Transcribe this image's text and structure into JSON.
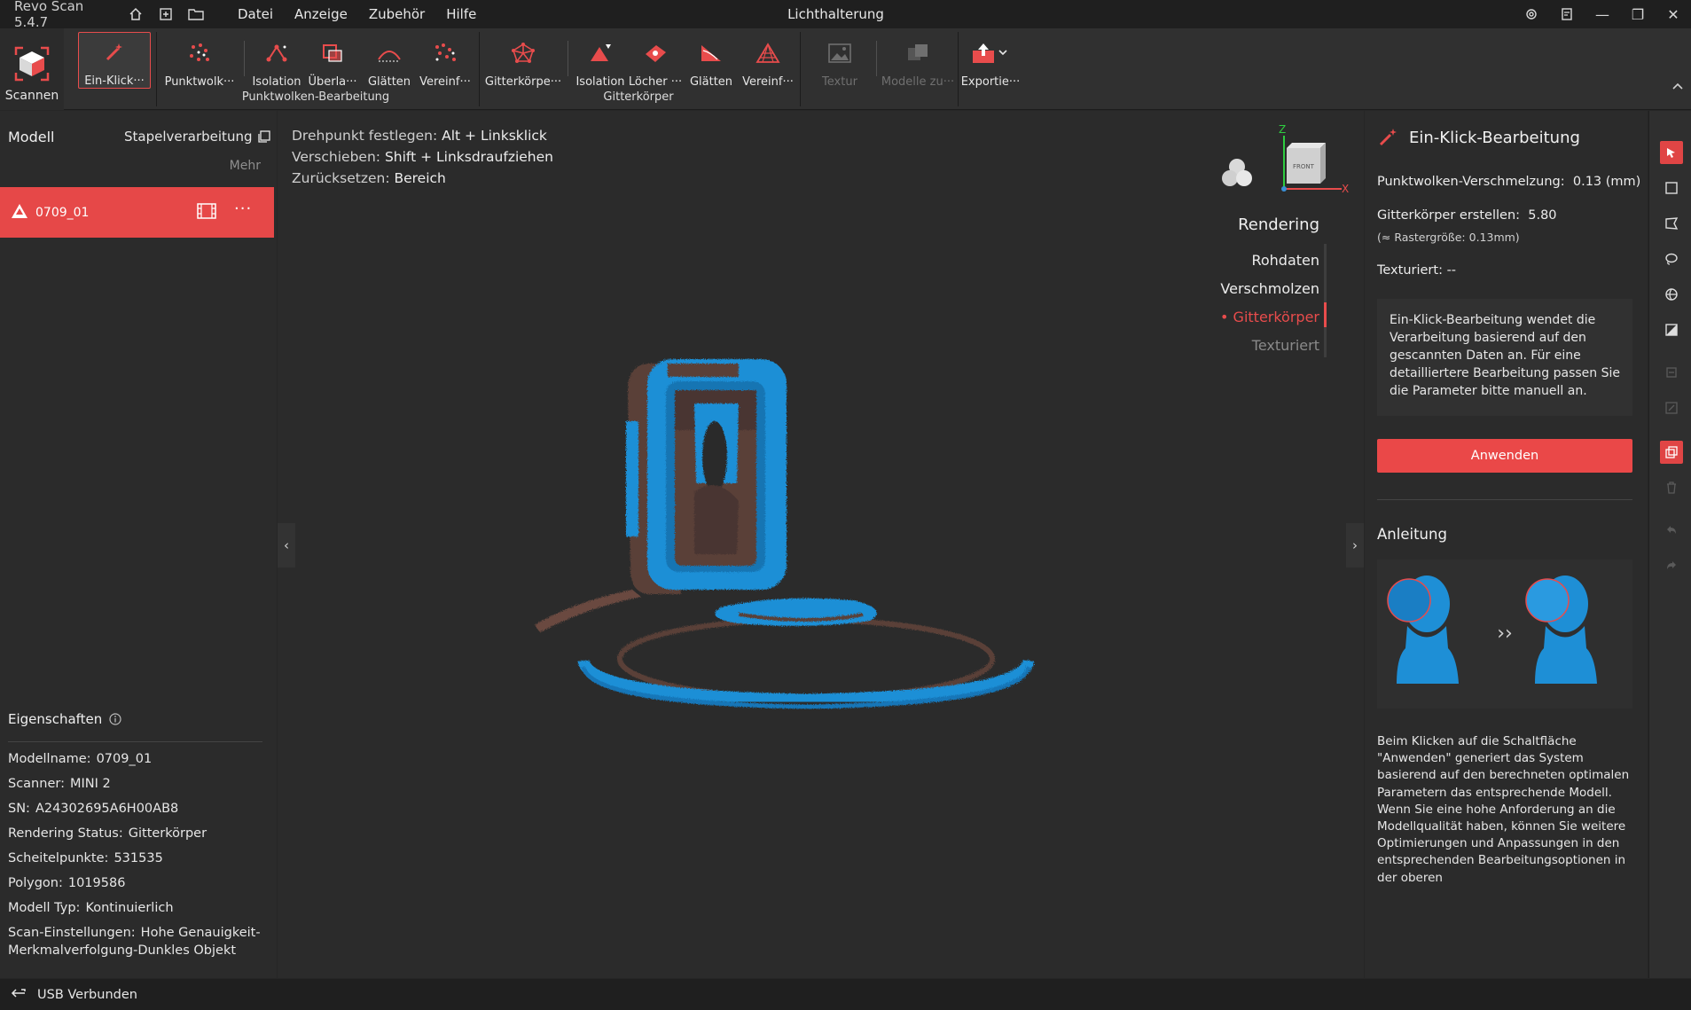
{
  "app": {
    "name": "Revo Scan 5.4.7",
    "window_title": "Lichthalterung",
    "menu": [
      "Datei",
      "Anzeige",
      "Zubehör",
      "Hilfe"
    ]
  },
  "toolbar": {
    "scan_label": "Scannen",
    "one_click_label": "Ein-Klick···",
    "pointcloud_tools": [
      "Punktwolk···",
      "Isolation",
      "Überla···",
      "Glätten",
      "Vereinf···"
    ],
    "pointcloud_group": "Punktwolken-Bearbeitung",
    "mesh_tools": [
      "Gitterkörpe···",
      "Isolation",
      "Löcher ···",
      "Glätten",
      "Vereinf···"
    ],
    "mesh_group": "Gitterkörper",
    "texture_label": "Textur",
    "merge_label": "Modelle zu···",
    "export_label": "Exportie···"
  },
  "left": {
    "title": "Modell",
    "batch_label": "Stapelverarbeitung",
    "more_label": "Mehr",
    "model_name": "0709_01",
    "model_menu": "···",
    "properties_title": "Eigenschaften",
    "properties": [
      {
        "label": "Modellname:",
        "value": "0709_01"
      },
      {
        "label": "Scanner:",
        "value": "MINI 2"
      },
      {
        "label": "SN:",
        "value": "A24302695A6H00AB8"
      },
      {
        "label": "Rendering Status:",
        "value": "Gitterkörper"
      },
      {
        "label": "Scheitelpunkte:",
        "value": "531535"
      },
      {
        "label": "Polygon:",
        "value": "1019586"
      },
      {
        "label": "Modell Typ:",
        "value": "Kontinuierlich"
      },
      {
        "label": "Scan-Einstellungen:",
        "value": "Hohe Genauigkeit-Merkmalverfolgung-Dunkles Objekt"
      }
    ]
  },
  "viewport": {
    "hints": [
      {
        "label": "Drehpunkt festlegen:",
        "value": "Alt + Linksklick"
      },
      {
        "label": "Verschieben:",
        "value": "Shift + Linksdraufziehen"
      },
      {
        "label": "Zurücksetzen:",
        "value": "Bereich"
      }
    ],
    "axis_z": "Z",
    "axis_x": "X",
    "cube_face": "FRONT",
    "rendering_title": "Rendering",
    "render_modes": [
      {
        "label": "Rohdaten",
        "state": "normal"
      },
      {
        "label": "Verschmolzen",
        "state": "normal"
      },
      {
        "label": "Gitterkörper",
        "state": "selected"
      },
      {
        "label": "Texturiert",
        "state": "disabled"
      }
    ]
  },
  "right": {
    "title": "Ein-Klick-Bearbeitung",
    "fusion_label": "Punktwolken-Verschmelzung:",
    "fusion_value": "0.13 (mm)",
    "mesh_label": "Gitterkörper erstellen:",
    "mesh_value": "5.80",
    "grid_note": "(≈ Rastergröße: 0.13mm)",
    "textured_label": "Texturiert:",
    "textured_value": "--",
    "info_text": "Ein-Klick-Bearbeitung wendet die Verarbeitung basierend auf den gescannten Daten an. Für eine detailliertere Bearbeitung passen Sie die Parameter bitte manuell an.",
    "apply_label": "Anwenden",
    "guide_title": "Anleitung",
    "guide_arrow": "››",
    "guide_text": "Beim Klicken auf die Schaltfläche \"Anwenden\" generiert das System basierend auf den berechneten optimalen Parametern das entsprechende Modell. Wenn Sie eine hohe Anforderung an die Modellqualität haben, können Sie weitere Optimierungen und Anpassungen in den entsprechenden Bearbeitungsoptionen in der oberen"
  },
  "status": {
    "connection": "USB Verbunden"
  },
  "colors": {
    "accent": "#e84c4c",
    "mesh_blue": "#1e8fd6",
    "mesh_brown": "#5a4038",
    "background": "#262626"
  }
}
